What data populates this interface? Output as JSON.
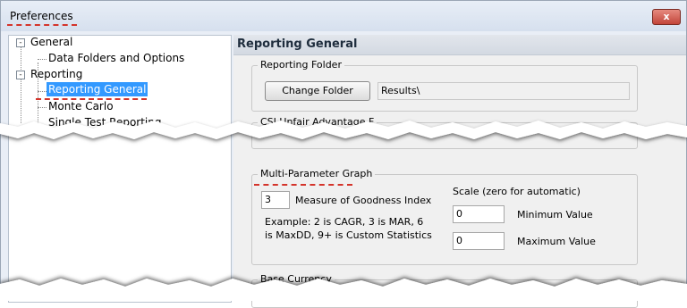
{
  "window": {
    "title": "Preferences",
    "close_label": "x"
  },
  "tree": {
    "items": [
      {
        "label": "General",
        "expander": "-"
      },
      {
        "label": "Data Folders and Options"
      },
      {
        "label": "Reporting",
        "expander": "-"
      },
      {
        "label": "Reporting General",
        "selected": true
      },
      {
        "label": "Monte Carlo"
      },
      {
        "label": "Single Test Reporting"
      }
    ]
  },
  "panel": {
    "title": "Reporting General",
    "reporting_folder": {
      "group_label": "Reporting Folder",
      "button_label": "Change Folder",
      "path_value": "Results\\"
    },
    "csi": {
      "group_label": "CSI Unfair Advantage F"
    },
    "multi_parameter_graph": {
      "group_label": "Multi-Parameter Graph",
      "measure_value": "3",
      "measure_label": "Measure of Goodness Index",
      "example_line1": "Example: 2 is CAGR, 3 is MAR, 6",
      "example_line2": "is MaxDD, 9+ is Custom Statistics",
      "scale_label": "Scale (zero for automatic)",
      "min_value": "0",
      "min_label": "Minimum Value",
      "max_value": "0",
      "max_label": "Maximum Value"
    },
    "base_currency": {
      "group_label": "Base Currency"
    }
  },
  "colors": {
    "annotation": "#d4342b",
    "selection": "#3399ff"
  },
  "icons": {
    "close": "close-icon"
  }
}
